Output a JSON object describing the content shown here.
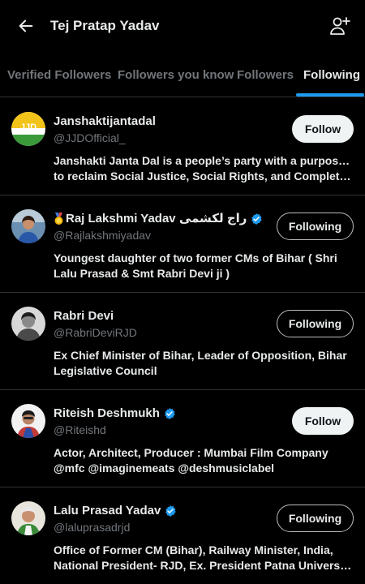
{
  "header": {
    "title": "Tej Pratap Yadav",
    "back_icon": "arrow-left-icon",
    "add_user_icon": "add-user-icon"
  },
  "tabs": [
    {
      "label": "Verified Followers",
      "active": false
    },
    {
      "label": "Followers you know",
      "active": false
    },
    {
      "label": "Followers",
      "active": false
    },
    {
      "label": "Following",
      "active": true
    }
  ],
  "colors": {
    "background": "#000000",
    "text": "#e7e9ea",
    "muted": "#71767b",
    "accent": "#1d9bf0",
    "divider": "#2f3336"
  },
  "users": [
    {
      "name": "Janshaktijantadal",
      "handle": "@JJDOfficial_",
      "verified": false,
      "button": "Follow",
      "bio": [
        "Janshakti Janta Dal is a people’s party with a purpose —",
        "to reclaim Social Justice, Social Rights, and Complete ..."
      ],
      "avatar_text": "JJD"
    },
    {
      "name": "Raj Lakshmi Yadav راج لکشمی",
      "handle": "@Rajlakshmiyadav",
      "verified": true,
      "button": "Following",
      "bio": [
        "Youngest daughter of two former CMs of Bihar ( Shri",
        "Lalu Prasad & Smt Rabri Devi ji )"
      ]
    },
    {
      "name": "Rabri Devi",
      "handle": "@RabriDeviRJD",
      "verified": false,
      "button": "Following",
      "bio": [
        "Ex Chief Minister of Bihar, Leader of Opposition, Bihar",
        "Legislative Council"
      ]
    },
    {
      "name": "Riteish Deshmukh",
      "handle": "@Riteishd",
      "verified": true,
      "button": "Follow",
      "bio": [
        "Actor, Architect, Producer : Mumbai Film Company",
        "@mfc @imaginemeats @deshmusiclabel"
      ]
    },
    {
      "name": "Lalu Prasad Yadav",
      "handle": "@laluprasadrjd",
      "verified": true,
      "button": "Following",
      "bio": [
        "Office of Former CM (Bihar), Railway Minister, India,",
        "National President- RJD, Ex. President Patna Universit..."
      ]
    }
  ]
}
